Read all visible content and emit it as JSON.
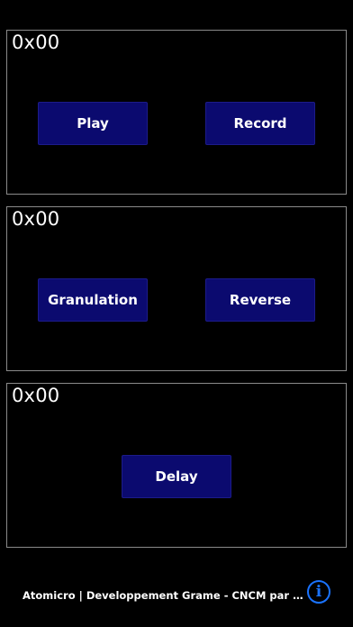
{
  "panels": [
    {
      "code": "0x00",
      "buttons": [
        "Play",
        "Record"
      ]
    },
    {
      "code": "0x00",
      "buttons": [
        "Granulation",
        "Reverse"
      ]
    },
    {
      "code": "0x00",
      "buttons": [
        "Delay"
      ]
    }
  ],
  "footer": {
    "text": "Atomicro | Developpement Grame - CNCM par E...",
    "info_glyph": "i",
    "info_icon": "info-icon"
  },
  "colors": {
    "background": "#000000",
    "button_fill": "#0b0a6f",
    "panel_border": "#8a8a8a",
    "info_accent": "#1a73ff"
  }
}
